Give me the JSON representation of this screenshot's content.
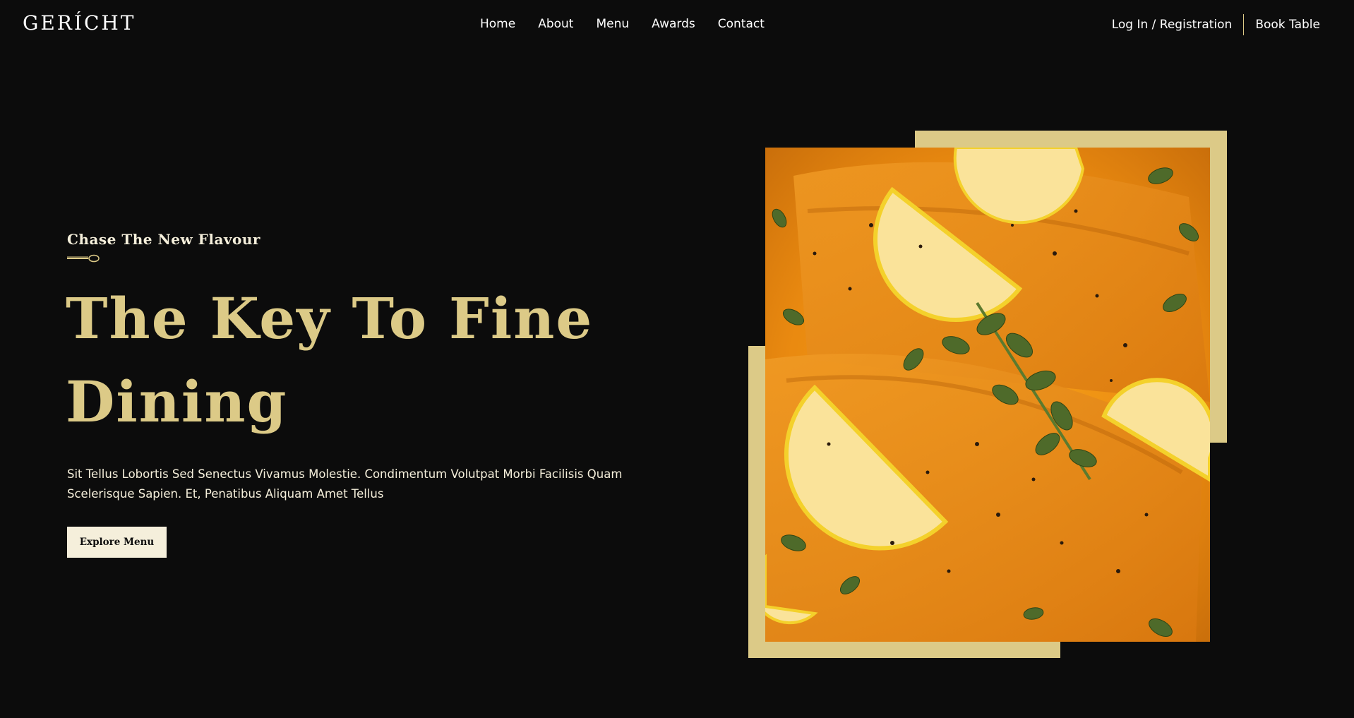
{
  "nav": {
    "logo": "GERÍCHT",
    "links": [
      "Home",
      "About",
      "Menu",
      "Awards",
      "Contact"
    ],
    "login": "Log In / Registration",
    "book": "Book Table"
  },
  "hero": {
    "subtitle": "Chase The New Flavour",
    "headline": "The Key To Fine Dining",
    "description": "Sit Tellus Lobortis Sed Senectus Vivamus Molestie. Condimentum Volutpat Morbi Facilisis Quam Scelerisque Sapien. Et, Penatibus Aliquam Amet Tellus",
    "cta_label": "Explore Menu",
    "image_icon": "salmon-dish-photo"
  },
  "colors": {
    "background": "#0c0c0c",
    "gold": "#dcca87",
    "cream": "#f5efdb",
    "white": "#ffffff"
  }
}
